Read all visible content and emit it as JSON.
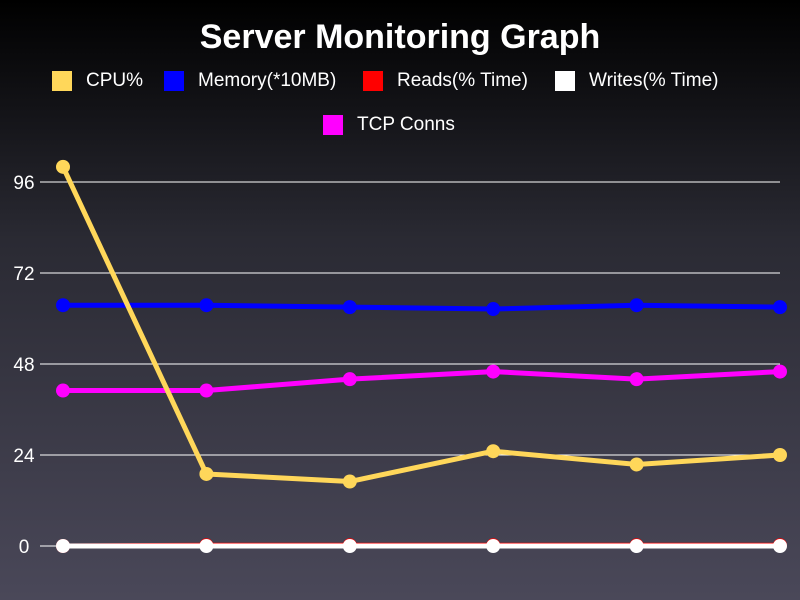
{
  "chart_data": {
    "type": "line",
    "title": "Server Monitoring Graph",
    "xlabel": "",
    "ylabel": "",
    "ylim": [
      0,
      100
    ],
    "yticks": [
      0,
      24,
      48,
      72,
      96
    ],
    "x": [
      1,
      2,
      3,
      4,
      5,
      6
    ],
    "grid": true,
    "legend_position": "top",
    "series": [
      {
        "name": "CPU%",
        "color": "#FFD75A",
        "values": [
          100,
          19,
          17,
          25,
          21.5,
          24
        ]
      },
      {
        "name": "Memory(*10MB)",
        "color": "#0000FF",
        "values": [
          63.5,
          63.5,
          63,
          62.5,
          63.5,
          63
        ]
      },
      {
        "name": "Reads(% Time)",
        "color": "#FF0000",
        "values": [
          0,
          0.2,
          0.2,
          0.2,
          0.2,
          0.2
        ]
      },
      {
        "name": "Writes(% Time)",
        "color": "#FFFFFF",
        "values": [
          0,
          0,
          0,
          0,
          0,
          0
        ]
      },
      {
        "name": "TCP Conns",
        "color": "#FF00FF",
        "values": [
          41,
          41,
          44,
          46,
          44,
          46
        ]
      }
    ]
  }
}
